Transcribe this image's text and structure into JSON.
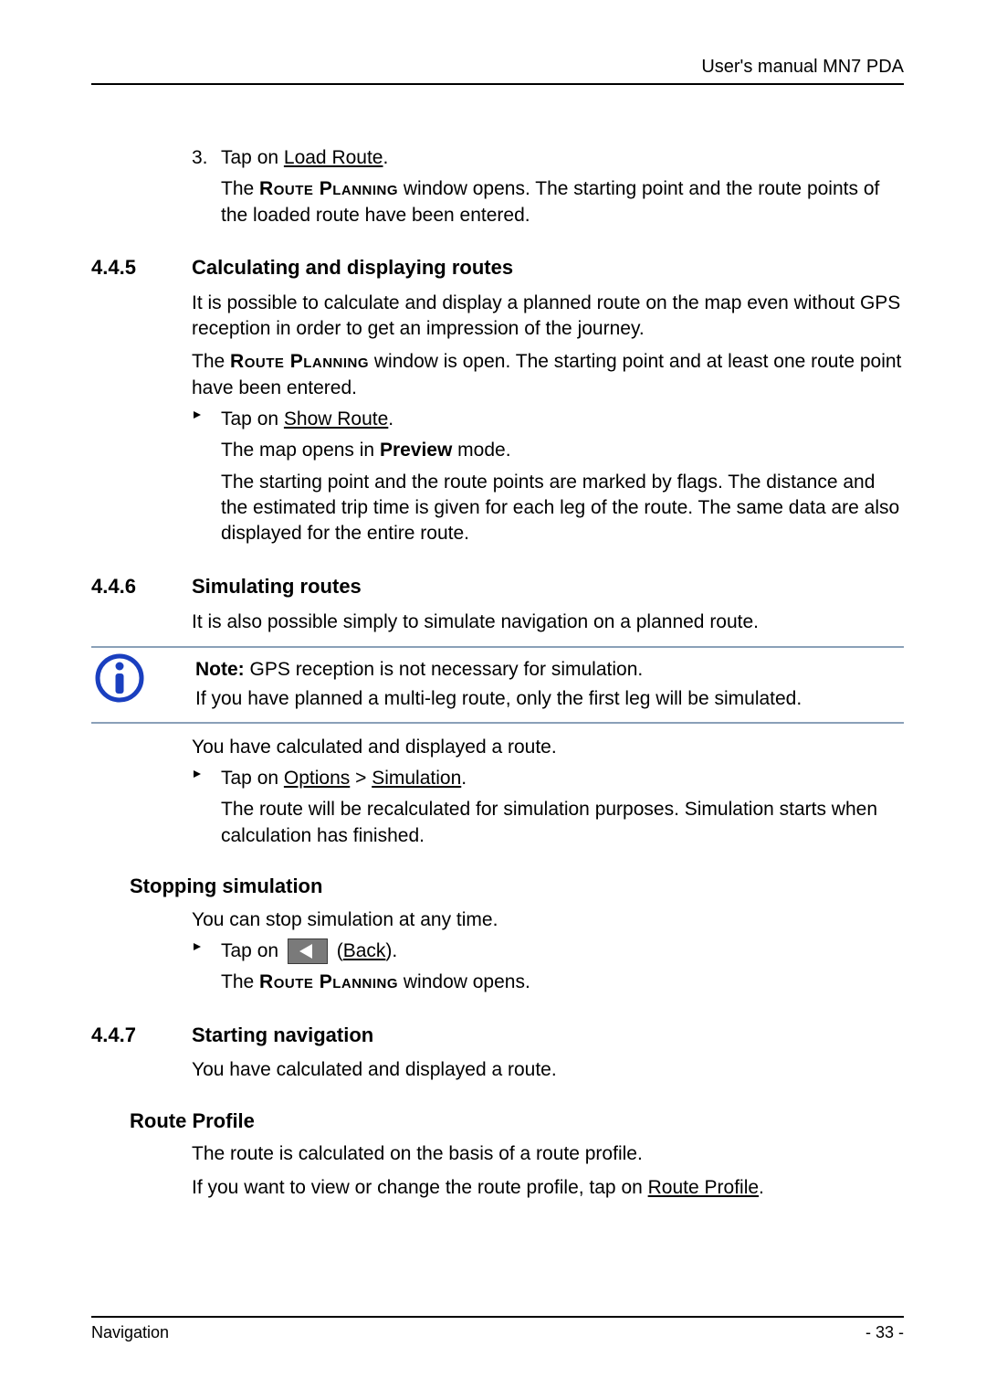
{
  "header": {
    "title": "User's manual MN7 PDA"
  },
  "step3": {
    "marker": "3.",
    "pre": "Tap on ",
    "link": "Load Route",
    "post": ".",
    "result_pre": "The ",
    "result_sc": "Route Planning",
    "result_post": " window opens. The starting point and the route points of the loaded route have been entered."
  },
  "s445": {
    "num": "4.4.5",
    "title": "Calculating and displaying routes",
    "p1": "It is possible to calculate and display a planned route on the map even without GPS reception in order to get an impression of the journey.",
    "p2_pre": "The ",
    "p2_sc": "Route Planning",
    "p2_post": " window is open. The starting point and at least one route point have been entered.",
    "b1_pre": "Tap on ",
    "b1_link": "Show Route",
    "b1_post": ".",
    "b1_r1_pre": "The map opens in ",
    "b1_r1_bold": "Preview",
    "b1_r1_post": " mode.",
    "b1_r2": "The starting point and the route points are marked by flags. The distance and the estimated trip time is given for each leg of the route. The same data are also displayed for the entire route."
  },
  "s446": {
    "num": "4.4.6",
    "title": "Simulating routes",
    "p1": "It is also possible simply to simulate navigation on a planned route.",
    "note_l1_bold": "Note:",
    "note_l1_rest": " GPS reception is not necessary for simulation.",
    "note_l2": "If you have planned a multi-leg route, only the first leg will be simulated.",
    "p2": "You have calculated and displayed a route.",
    "b1_pre": "Tap on ",
    "b1_link1": "Options",
    "b1_mid": " > ",
    "b1_link2": "Simulation",
    "b1_post": ".",
    "b1_r1": "The route will be recalculated for simulation purposes. Simulation starts when calculation has finished."
  },
  "stopping": {
    "title": "Stopping simulation",
    "p1": "You can stop simulation at any time.",
    "b1_pre": "Tap on ",
    "b1_paren_open": " (",
    "b1_link": "Back",
    "b1_paren_close": ").",
    "r1_pre": "The ",
    "r1_sc": "Route Planning",
    "r1_post": " window opens."
  },
  "s447": {
    "num": "4.4.7",
    "title": "Starting navigation",
    "p1": "You have calculated and displayed a route."
  },
  "routeprofile": {
    "title": "Route Profile",
    "p1": "The route is calculated on the basis of a route profile.",
    "p2_pre": "If you want to view or change the route profile, tap on ",
    "p2_link": "Route Profile",
    "p2_post": "."
  },
  "footer": {
    "left": "Navigation",
    "right": "- 33 -"
  }
}
